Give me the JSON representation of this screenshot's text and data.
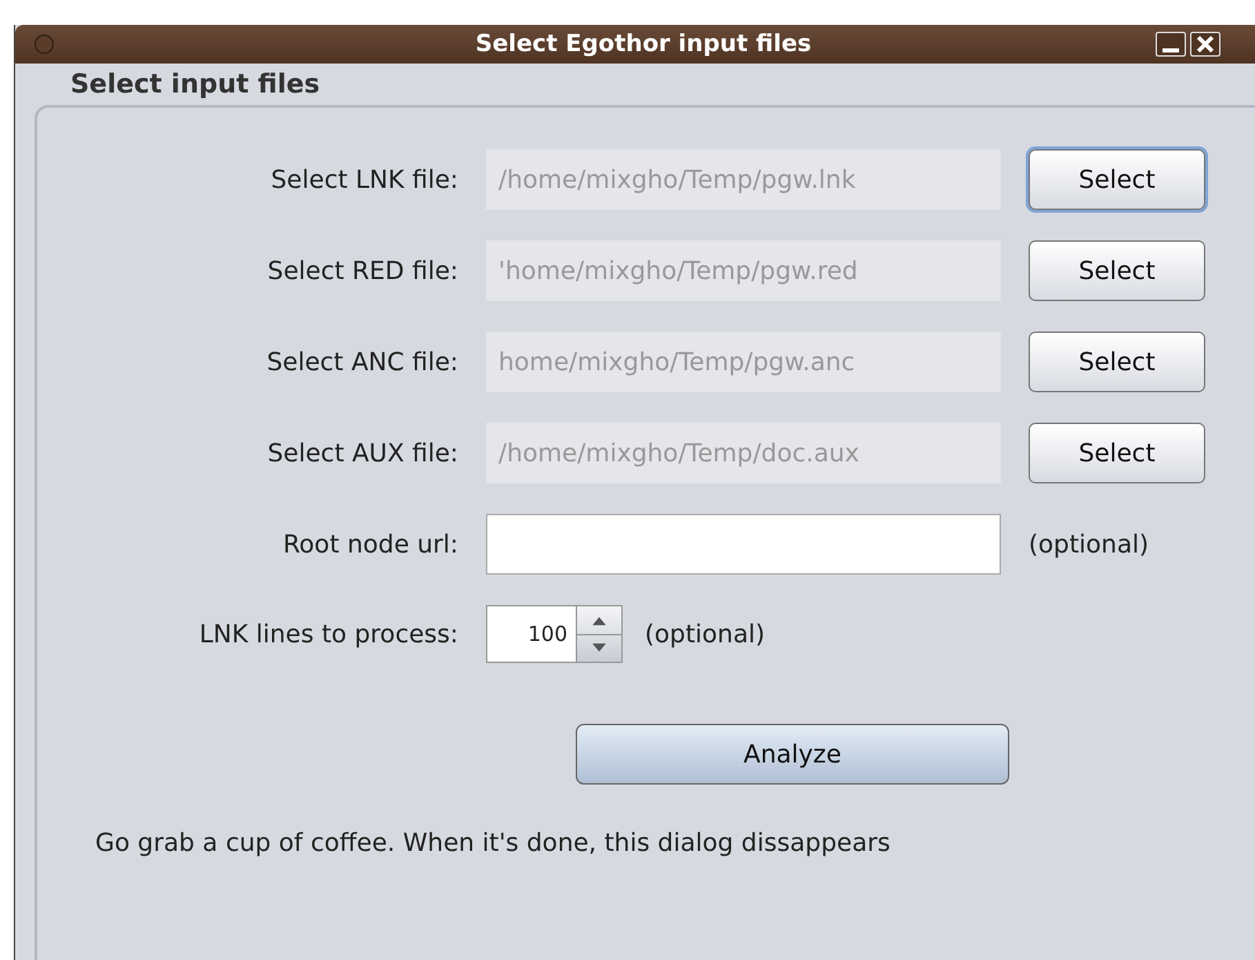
{
  "window": {
    "title": "Select Egothor input files"
  },
  "group": {
    "title": "Select input files"
  },
  "file_rows": [
    {
      "label": "Select LNK file:",
      "value": "/home/mixgho/Temp/pgw.lnk",
      "disabled": true,
      "button": "Select",
      "focused": true
    },
    {
      "label": "Select RED file:",
      "value": "'home/mixgho/Temp/pgw.red",
      "disabled": true,
      "button": "Select",
      "focused": false
    },
    {
      "label": "Select ANC file:",
      "value": "home/mixgho/Temp/pgw.anc",
      "disabled": true,
      "button": "Select",
      "focused": false
    },
    {
      "label": "Select AUX file:",
      "value": "/home/mixgho/Temp/doc.aux",
      "disabled": true,
      "button": "Select",
      "focused": false
    }
  ],
  "root_url": {
    "label": "Root node url:",
    "hint": "(optional)"
  },
  "lnk_lines": {
    "label": "LNK lines to process:",
    "value": "100",
    "hint": "(optional)"
  },
  "analyze_button": "Analyze",
  "message": "Go grab a cup of coffee. When it's done, this dialog dissappears"
}
